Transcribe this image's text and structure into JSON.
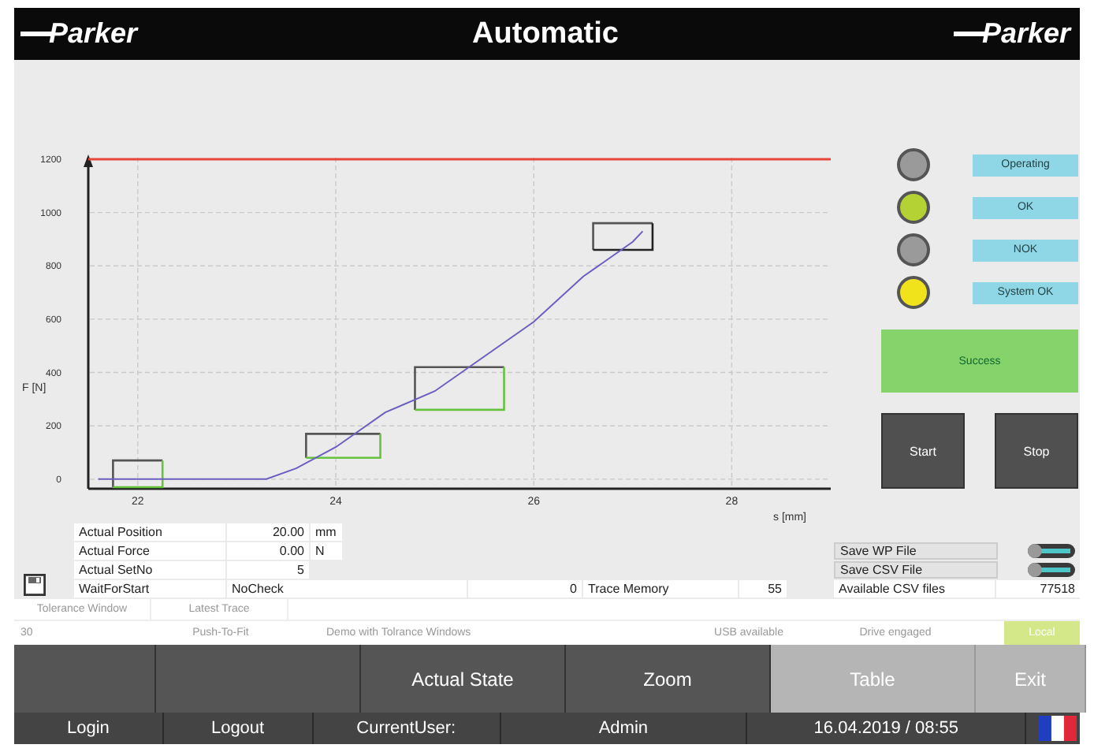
{
  "header": {
    "logo_left": "Parker",
    "title": "Automatic",
    "logo_right": "Parker"
  },
  "chart": {
    "chart_data": {
      "type": "line",
      "ylabel": "F [N]",
      "xlabel": "s [mm]",
      "xlim": [
        21.5,
        29.0
      ],
      "ylim": [
        -36,
        1200
      ],
      "xticks": [
        22,
        24,
        26,
        28
      ],
      "yticks": [
        0,
        200,
        400,
        600,
        800,
        1000,
        1200
      ],
      "grid": true,
      "x": [
        21.6,
        22,
        23,
        23.3,
        23.6,
        24,
        24.5,
        25,
        25.5,
        26,
        26.5,
        27,
        27.1
      ],
      "series": [
        {
          "color": "#6a5fc0",
          "values": [
            0,
            0,
            0,
            0,
            40,
            120,
            250,
            330,
            460,
            590,
            760,
            890,
            930
          ]
        }
      ],
      "ref_lines": [
        {
          "axis": "y",
          "value": 1200,
          "color": "#e8463a"
        }
      ]
    }
  },
  "lamps": [
    {
      "label": "Operating",
      "color": "#9a9a9a"
    },
    {
      "label": "OK",
      "color": "#b4d234"
    },
    {
      "label": "NOK",
      "color": "#9a9a9a"
    },
    {
      "label": "System OK",
      "color": "#f0e31c"
    }
  ],
  "result": "Success",
  "buttons": [
    "Start",
    "Stop"
  ],
  "readings": [
    {
      "label": "Actual Position",
      "value": "20.00",
      "unit": "mm"
    },
    {
      "label": "Actual Force",
      "value": "0.00",
      "unit": "N"
    },
    {
      "label": "Actual SetNo",
      "value": "5"
    }
  ],
  "state_row": {
    "state": "WaitForStart",
    "check": "NoCheck",
    "count": "0",
    "memory_label": "Trace Memory",
    "memory": "55"
  },
  "files": {
    "toggles": [
      {
        "label": "Save WP File",
        "on": false
      },
      {
        "label": "Save CSV File",
        "on": false
      }
    ],
    "available_label": "Available CSV files",
    "available": "77518"
  },
  "tabs": [
    {
      "label": "Tolerance Window"
    },
    {
      "label": "Latest Trace"
    }
  ],
  "status": [
    {
      "text": "30",
      "highlight": false
    },
    {
      "text": "Push-To-Fit",
      "highlight": false
    },
    {
      "text": "Demo with Tolrance Windows",
      "highlight": false
    },
    {
      "text": "USB available",
      "highlight": false
    },
    {
      "text": "Drive engaged",
      "highlight": false
    },
    {
      "text": "Local",
      "highlight": true
    }
  ],
  "nav": [
    {
      "highlighted": false
    },
    {
      "highlighted": false
    },
    {
      "label": "Actual State",
      "highlighted": false
    },
    {
      "label": "Zoom",
      "highlighted": false
    },
    {
      "label": "Table",
      "highlighted": true
    },
    {
      "label": "Exit",
      "highlighted": true
    }
  ],
  "footer": {
    "login": "Login",
    "logout": "Logout",
    "user_label": "CurrentUser:",
    "user": "Admin",
    "datetime": "16.04.2019 / 08:55"
  }
}
